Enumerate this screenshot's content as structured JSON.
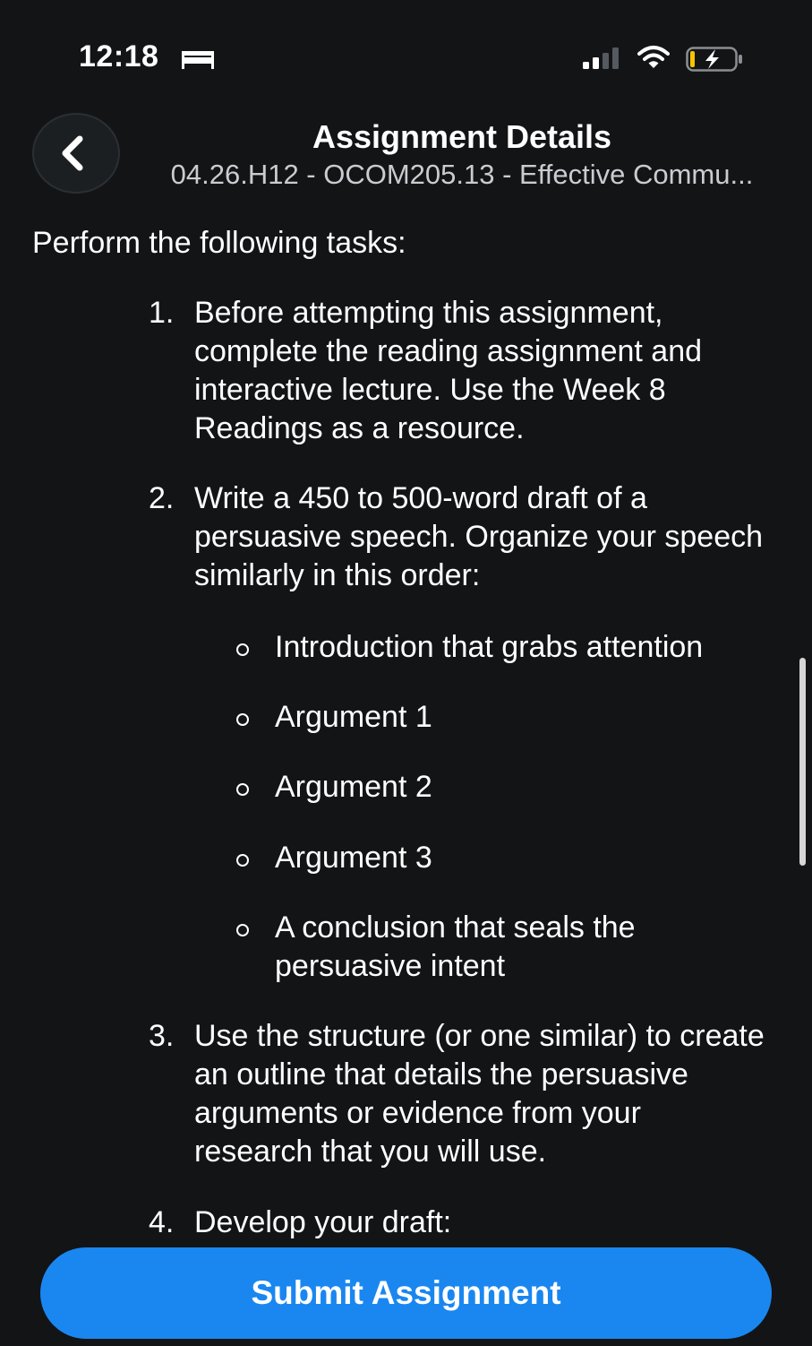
{
  "status_bar": {
    "time": "12:18",
    "icons": [
      "bed-icon",
      "cellular-signal-icon",
      "wifi-icon",
      "battery-charging-icon"
    ]
  },
  "header": {
    "back_icon": "chevron-left-icon",
    "title": "Assignment Details",
    "subtitle": "04.26.H12 - OCOM205.13 - Effective Commu..."
  },
  "content": {
    "intro": "Perform the following tasks:",
    "tasks": [
      {
        "number": "1.",
        "text": "Before attempting this assignment, complete the reading assignment and interactive lecture. Use the Week 8 Readings as a resource."
      },
      {
        "number": "2.",
        "text": "Write a 450 to 500-word draft of a persuasive speech. Organize your speech similarly in this order:",
        "subitems": [
          "Introduction that grabs attention",
          "Argument 1",
          "Argument 2",
          "Argument 3",
          "A conclusion that seals the persuasive intent"
        ]
      },
      {
        "number": "3.",
        "text": "Use the structure (or one similar) to create an outline that details the persuasive arguments or evidence from your research that you will use."
      },
      {
        "number": "4.",
        "text": "Develop your draft:"
      }
    ]
  },
  "footer": {
    "submit_label": "Submit Assignment"
  },
  "colors": {
    "background": "#121416",
    "accent": "#1a87f0",
    "subtitle": "#c9ccd0"
  }
}
